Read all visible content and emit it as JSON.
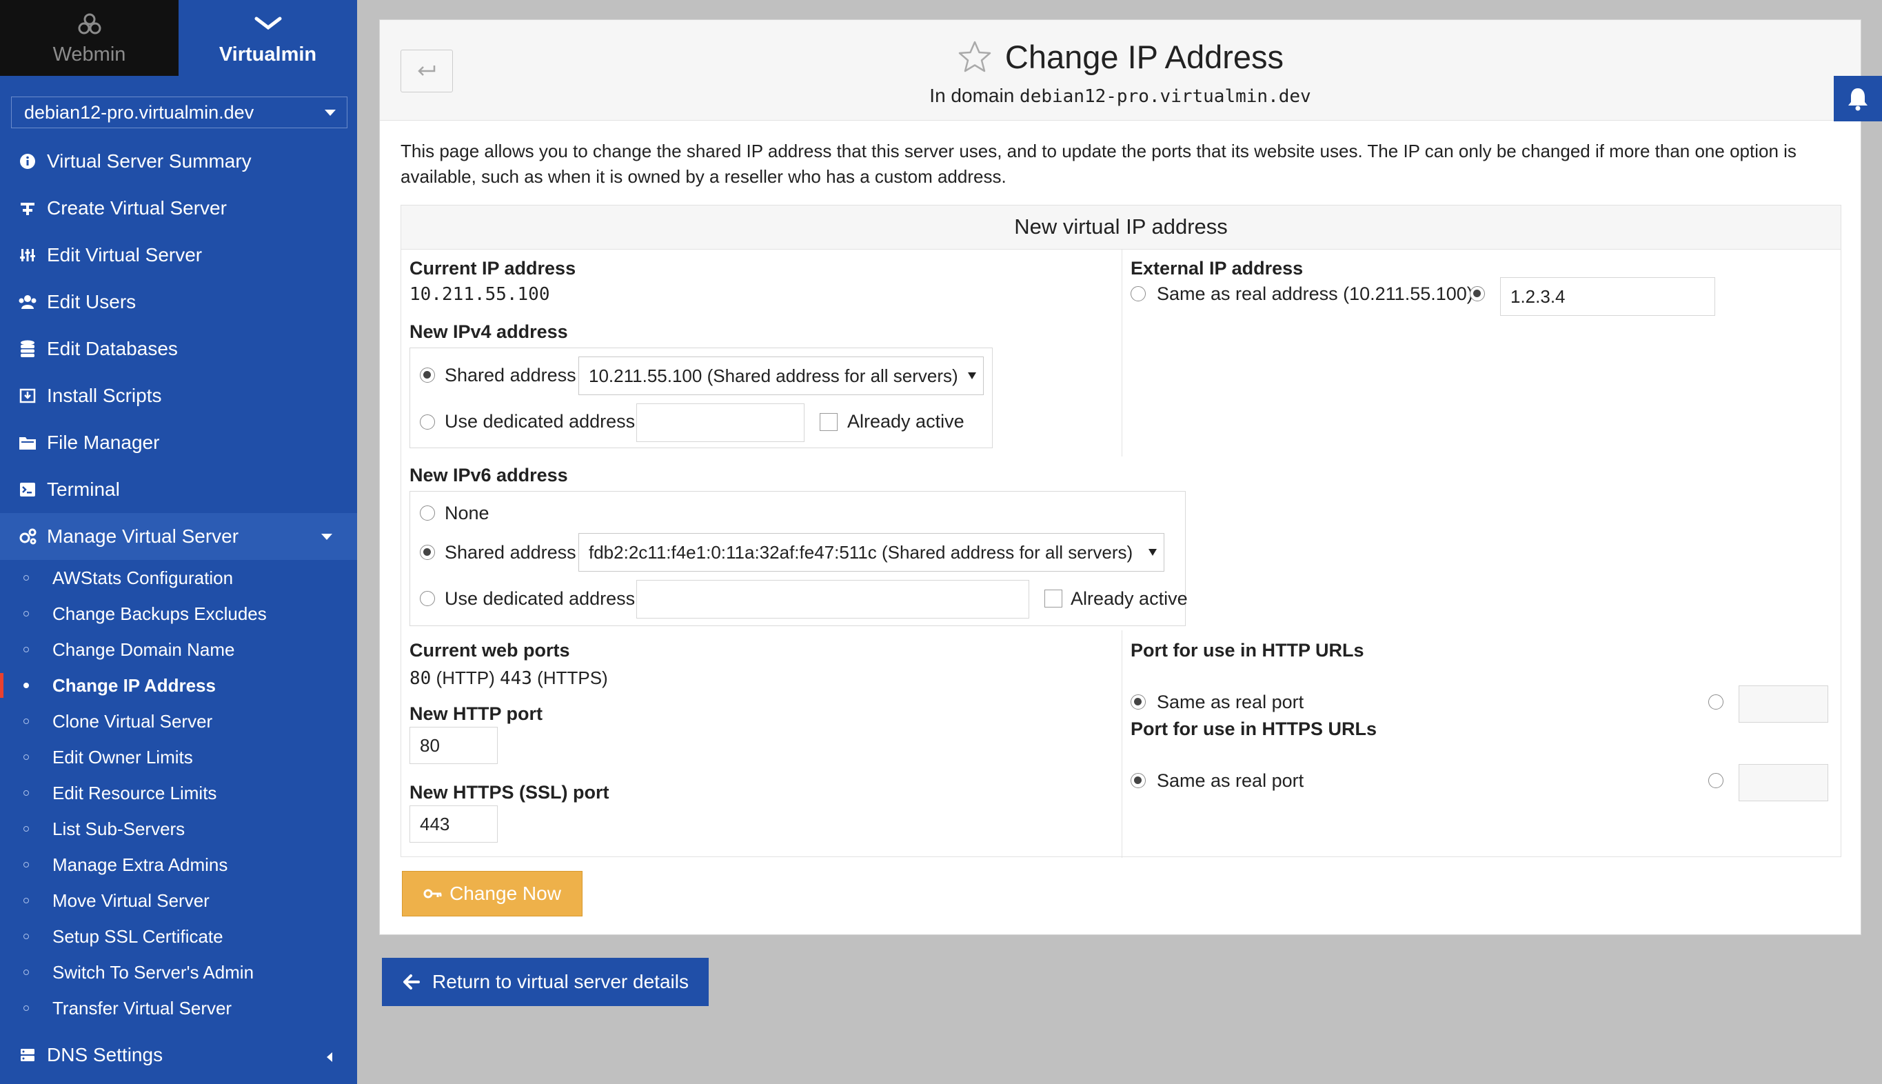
{
  "switcher": {
    "webmin": "Webmin",
    "virtualmin": "Virtualmin"
  },
  "domain_select": "debian12-pro.virtualmin.dev",
  "nav": {
    "virtual_server_summary": "Virtual Server Summary",
    "create_virtual_server": "Create Virtual Server",
    "edit_virtual_server": "Edit Virtual Server",
    "edit_users": "Edit Users",
    "edit_databases": "Edit Databases",
    "install_scripts": "Install Scripts",
    "file_manager": "File Manager",
    "terminal": "Terminal",
    "manage_virtual_server": "Manage Virtual Server",
    "dns_settings": "DNS Settings"
  },
  "subnav": [
    "AWStats Configuration",
    "Change Backups Excludes",
    "Change Domain Name",
    "Change IP Address",
    "Clone Virtual Server",
    "Edit Owner Limits",
    "Edit Resource Limits",
    "List Sub-Servers",
    "Manage Extra Admins",
    "Move Virtual Server",
    "Setup SSL Certificate",
    "Switch To Server's Admin",
    "Transfer Virtual Server"
  ],
  "header": {
    "title": "Change IP Address",
    "subtitle_prefix": "In domain ",
    "subtitle_domain": "debian12-pro.virtualmin.dev"
  },
  "intro": "This page allows you to change the shared IP address that this server uses, and to update the ports that its website uses. The IP can only be changed if more than one option is available, such as when it is owned by a reseller who has a custom address.",
  "form": {
    "heading": "New virtual IP address",
    "current_ip_label": "Current IP address",
    "current_ip_value": "10.211.55.100",
    "new_ipv4_label": "New IPv4 address",
    "ipv4_shared_label": "Shared address",
    "ipv4_shared_select": "10.211.55.100 (Shared address for all servers)",
    "ipv4_dedicated_label": "Use dedicated address",
    "ipv4_dedicated_value": "",
    "already_active_label": "Already active",
    "external_ip_label": "External IP address",
    "external_same_label": "Same as real address (10.211.55.100)",
    "external_value": "1.2.3.4",
    "new_ipv6_label": "New IPv6 address",
    "ipv6_none_label": "None",
    "ipv6_shared_label": "Shared address",
    "ipv6_shared_select": "fdb2:2c11:f4e1:0:11a:32af:fe47:511c (Shared address for all servers)",
    "ipv6_dedicated_label": "Use dedicated address",
    "ipv6_dedicated_value": "",
    "ipv6_already_active_label": "Already active",
    "current_ports_label": "Current web ports",
    "current_ports_http": "80",
    "current_ports_http_suffix": " (HTTP) ",
    "current_ports_https": "443",
    "current_ports_https_suffix": " (HTTPS)",
    "new_http_port_label": "New HTTP port",
    "new_http_port_value": "80",
    "new_https_port_label": "New HTTPS (SSL) port",
    "new_https_port_value": "443",
    "http_urls_label": "Port for use in HTTP URLs",
    "http_urls_same_label": "Same as real port",
    "http_urls_value": "",
    "https_urls_label": "Port for use in HTTPS URLs",
    "https_urls_same_label": "Same as real port",
    "https_urls_value": ""
  },
  "buttons": {
    "change_now": "Change Now",
    "return": "Return to virtual server details"
  },
  "colors": {
    "sidebar": "#204fa8",
    "accent_button": "#eeb14a",
    "active_marker": "#e8412f"
  }
}
